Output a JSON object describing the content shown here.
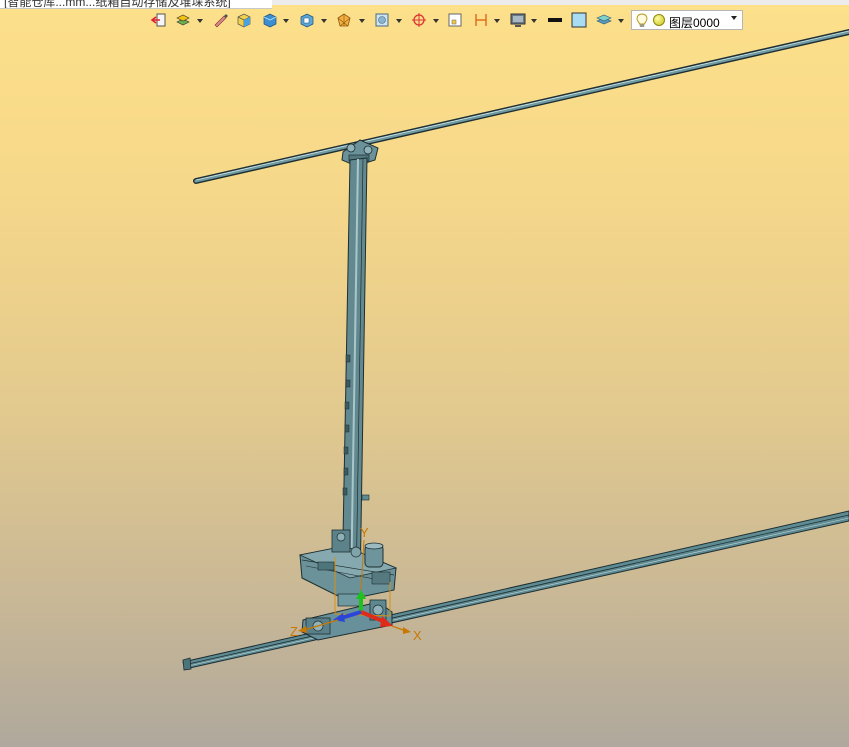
{
  "window": {
    "tab_title": "[智能仓库...mm...纸箱自动存储及堆垛系统]"
  },
  "toolbar": {
    "icons": [
      "exit-icon",
      "layers-icon",
      "pen-icon",
      "box-icon",
      "solid-icon",
      "section-icon",
      "wire-icon",
      "view-icon",
      "target-icon",
      "frame-icon",
      "dimension-icon",
      "display-icon",
      "line-color-icon",
      "fill-color-icon",
      "layer-stack-icon"
    ],
    "layer_select": {
      "value": "图层0000"
    }
  },
  "scene": {
    "axis_labels": {
      "x": "X",
      "y": "Y",
      "z": "Z"
    },
    "colors": {
      "model": "#5e8a92",
      "model_outline": "#1d2f33",
      "axis_x": "#e02a1a",
      "axis_y": "#1ec21e",
      "axis_z": "#2a45d8",
      "axis_label": "#c87800",
      "background_top": "#fde08a",
      "background_bottom": "#afa89c"
    }
  }
}
